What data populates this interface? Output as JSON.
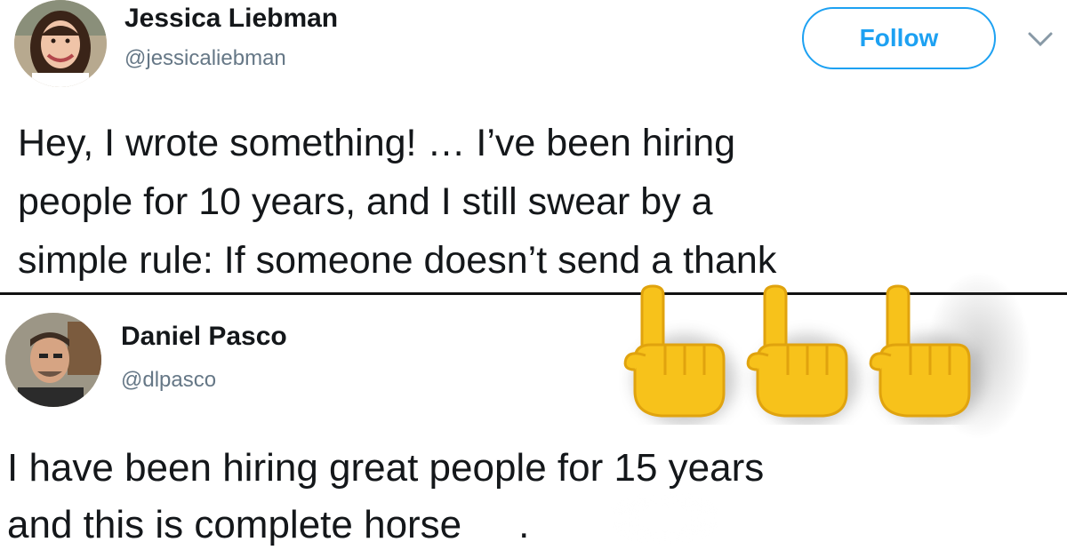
{
  "tweets": [
    {
      "name": "Jessica Liebman",
      "handle": "@jessicaliebman",
      "follow_label": "Follow",
      "lines": [
        "Hey, I wrote something! … I’ve been hiring",
        "people for 10 years, and I still swear by a",
        "simple rule: If someone doesn’t send a thank"
      ]
    },
    {
      "name": "Daniel Pasco",
      "handle": "@dlpasco",
      "lines": [
        "I have been hiring great people for 15 years",
        "and this is complete horse"
      ],
      "censored_tail": "."
    }
  ],
  "icons": {
    "follow_menu": "chevron-down-icon",
    "overlay": "index-pointing-up-emoji"
  },
  "colors": {
    "accent": "#1da1f2",
    "text": "#14171a",
    "secondary": "#657786",
    "emoji": "#f7c21b"
  }
}
